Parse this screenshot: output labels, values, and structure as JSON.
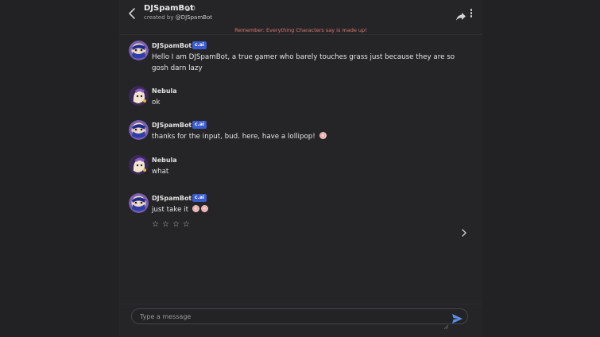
{
  "header": {
    "bot_name": "DJSpamBot",
    "chat_count": "0",
    "created_by_prefix": "created by ",
    "creator_handle": "@DJSpamBot"
  },
  "disclaimer": "Remember: Everything Characters say is made up!",
  "badge_label": "c.ai",
  "messages": [
    {
      "author": "DJSpamBot",
      "is_bot": true,
      "text": "Hello I am DJSpamBot, a true gamer who barely touches grass just because they are so gosh darn lazy"
    },
    {
      "author": "Nebula",
      "is_bot": false,
      "text": "ok"
    },
    {
      "author": "DJSpamBot",
      "is_bot": true,
      "text": "thanks for the input, bud. here, have a lollipop!"
    },
    {
      "author": "Nebula",
      "is_bot": false,
      "text": "what"
    },
    {
      "author": "DJSpamBot",
      "is_bot": true,
      "text": "just take it"
    }
  ],
  "rating": {
    "stars": [
      "☆",
      "☆",
      "☆",
      "☆"
    ],
    "value": 0,
    "max": 4
  },
  "composer": {
    "placeholder": "Type a message"
  },
  "icons": {
    "back": "chevron-left-icon",
    "share": "share-arrow-icon",
    "more": "kebab-menu-icon",
    "next": "chevron-right-icon",
    "send": "send-paper-plane-icon",
    "lollipop": "lollipop-emoji"
  },
  "colors": {
    "background": "#222225",
    "disclaimer": "#d9786e",
    "badge": "#3b5bd0",
    "send": "#5b8fe6"
  }
}
